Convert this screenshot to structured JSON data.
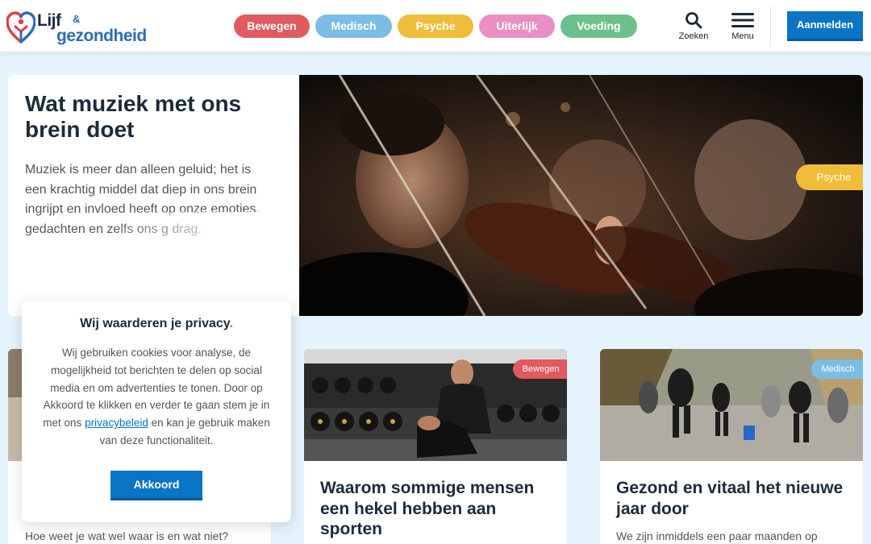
{
  "brand": {
    "logo_word1": "Lijf",
    "logo_amp": "&",
    "logo_word2": "gezondheid"
  },
  "nav": {
    "categories": [
      {
        "label": "Bewegen",
        "color": "#e05a5f"
      },
      {
        "label": "Medisch",
        "color": "#7cbde6"
      },
      {
        "label": "Psyche",
        "color": "#efbd3a"
      },
      {
        "label": "Uiterlijk",
        "color": "#e98fc4"
      },
      {
        "label": "Voeding",
        "color": "#6cc08b"
      }
    ],
    "search_label": "Zoeken",
    "search_icon": "search-icon",
    "menu_label": "Menu",
    "menu_icon": "hamburger-icon",
    "login_label": "Aanmelden"
  },
  "hero": {
    "title": "Wat muziek met ons brein doet",
    "excerpt": "Muziek is meer dan alleen geluid; het is een krachtig middel dat diep in ons brein ingrijpt en invloed heeft op onze emoties, gedachten en zelfs ons g drag.",
    "tag": "Psyche",
    "image_desc": "violinists-orchestra-photo"
  },
  "cards": [
    {
      "excerpt": "Hoe weet je wat wel waar is en wat niet?"
    },
    {
      "title": "Waarom sommige mensen een hekel hebben aan sporten",
      "tag": "Bewegen",
      "tag_color": "#e05a5f"
    },
    {
      "title": "Gezond en vitaal het nieuwe jaar door",
      "excerpt": "We zijn inmiddels een paar maanden op",
      "tag": "Medisch",
      "tag_color": "#7cbde6"
    }
  ],
  "cookie": {
    "title": "Wij waarderen je privacy",
    "title_dot": ".",
    "body_before": "Wij gebruiken cookies voor analyse, de mogelijkheid tot berichten te delen op social media en om advertenties te tonen. Door op Akkoord te klikken en verder te gaan stem je in met ons ",
    "link": "privacybeleid",
    "body_after": " en kan je gebruik maken van deze functionaliteit.",
    "accept_label": "Akkoord"
  },
  "colors": {
    "primary": "#0a74c5",
    "background": "#e5f3fd"
  }
}
